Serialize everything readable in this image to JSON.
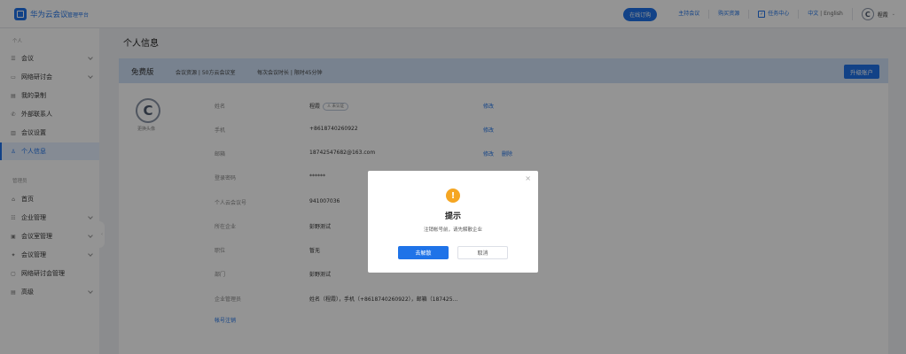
{
  "header": {
    "app_title": "华为云会议",
    "app_subtitle": "管理平台",
    "order_button": "在线订购",
    "links": [
      "主持会议",
      "购买资源"
    ],
    "task_center": "任务中心",
    "lang_active": "中文",
    "lang_inactive": "English",
    "user_initial": "C",
    "user_name": "程霞"
  },
  "sidebar": {
    "group_personal": "个人",
    "personal_items": [
      {
        "icon": "☰",
        "label": "会议"
      },
      {
        "icon": "▭",
        "label": "网络研讨会"
      },
      {
        "icon": "▤",
        "label": "我的录制"
      },
      {
        "icon": "✆",
        "label": "外部联系人"
      },
      {
        "icon": "▥",
        "label": "会议设置"
      },
      {
        "icon": "♙",
        "label": "个人信息"
      }
    ],
    "group_admin": "管理员",
    "admin_items": [
      {
        "icon": "⌂",
        "label": "首页"
      },
      {
        "icon": "☷",
        "label": "企业管理"
      },
      {
        "icon": "▣",
        "label": "会议室管理"
      },
      {
        "icon": "✦",
        "label": "会议管理"
      },
      {
        "icon": "▢",
        "label": "网络研讨会管理"
      },
      {
        "icon": "▤",
        "label": "高级"
      }
    ]
  },
  "main": {
    "page_title": "个人信息",
    "plan": {
      "name": "免费版",
      "resources": "会议资源 | 50方云会议室",
      "duration": "每次会议时长 | 限时45分钟",
      "upgrade": "升级账户"
    },
    "avatar_initial": "C",
    "avatar_caption": "更换头像",
    "fields": [
      {
        "label": "姓名",
        "value": "程霞",
        "badge": "♙ 未认证",
        "actions": [
          "修改"
        ]
      },
      {
        "label": "手机",
        "value": "+8618740260922",
        "actions": [
          "修改"
        ]
      },
      {
        "label": "邮箱",
        "value": "18742547682@163.com",
        "actions": [
          "修改",
          "删除"
        ]
      },
      {
        "label": "登录密码",
        "value": "******",
        "actions": []
      },
      {
        "label": "个人云会议号",
        "value": "941007036",
        "actions": []
      },
      {
        "label": "所在企业",
        "value": "彭野测试",
        "actions": []
      },
      {
        "label": "职位",
        "value": "暂无",
        "actions": []
      },
      {
        "label": "部门",
        "value": "彭野测试",
        "actions": []
      },
      {
        "label": "企业管理员",
        "value": "姓名（程霞），手机（+8618740260922），邮箱（187425...",
        "actions": []
      }
    ],
    "delete_account": "帐号注销"
  },
  "dialog": {
    "icon": "!",
    "title": "提示",
    "message": "注销帐号前，请先解散企业",
    "primary": "去解散",
    "cancel": "取消",
    "close": "×"
  },
  "colors": {
    "accent": "#1f73e8",
    "warning": "#f5a623",
    "plan_bar": "#cfe0f6"
  }
}
